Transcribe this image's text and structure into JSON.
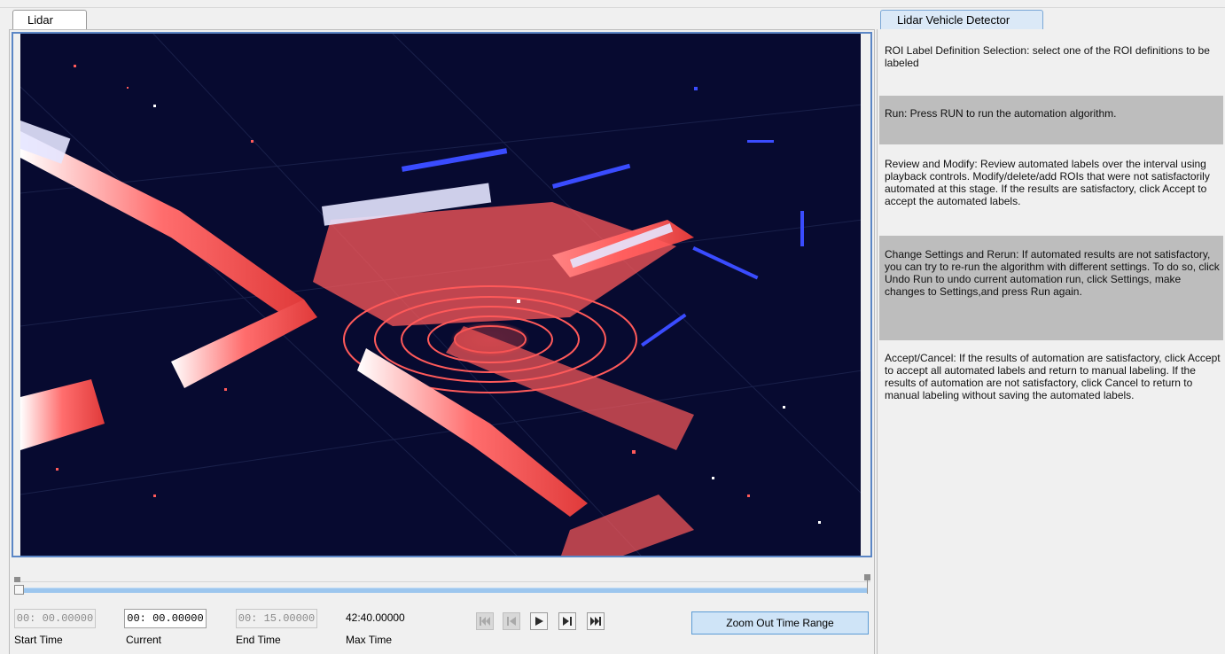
{
  "left_tab": {
    "label": "Lidar"
  },
  "right_tab": {
    "label": "Lidar Vehicle Detector"
  },
  "playback": {
    "start_time_value": "00:  00.00000",
    "current_value": "00:  00.00000",
    "end_time_value": "00:  15.00000",
    "max_time_value": "42:40.00000",
    "start_time_label": "Start Time",
    "current_label": "Current",
    "end_time_label": "End Time",
    "max_time_label": "Max Time",
    "zoom_button_label": "Zoom Out Time Range",
    "slider_position_fraction": 0
  },
  "instructions": [
    {
      "text": "ROI Label Definition Selection: select one of the ROI definitions to be labeled",
      "highlighted": false
    },
    {
      "text": "Run: Press RUN to run the automation algorithm.",
      "highlighted": true
    },
    {
      "text": "Review and Modify: Review automated labels over the interval using playback controls. Modify/delete/add ROIs that were not satisfactorily automated at this stage. If the results are satisfactory, click Accept to accept the automated labels.",
      "highlighted": false
    },
    {
      "text": "Change Settings and Rerun: If automated results are not satisfactory, you can try to re-run the algorithm with different settings. To do so, click Undo Run to undo current automation run, click Settings, make changes to Settings,and press Run again.",
      "highlighted": true
    },
    {
      "text": "Accept/Cancel: If the results of automation are satisfactory, click Accept to accept all automated labels and return to manual labeling. If the results of automation are not satisfactory, click Cancel to return to manual labeling without saving the automated labels.",
      "highlighted": false
    }
  ],
  "colors": {
    "viewer_background": "#070a30",
    "point_near": "#ff5a5a",
    "point_far": "#3a4cff",
    "highlight": "#bdbdbd",
    "zoom_button": "#cfe4f7"
  },
  "icons": [
    "jump-to-start-icon",
    "step-back-icon",
    "play-icon",
    "step-forward-icon",
    "jump-to-end-icon"
  ]
}
